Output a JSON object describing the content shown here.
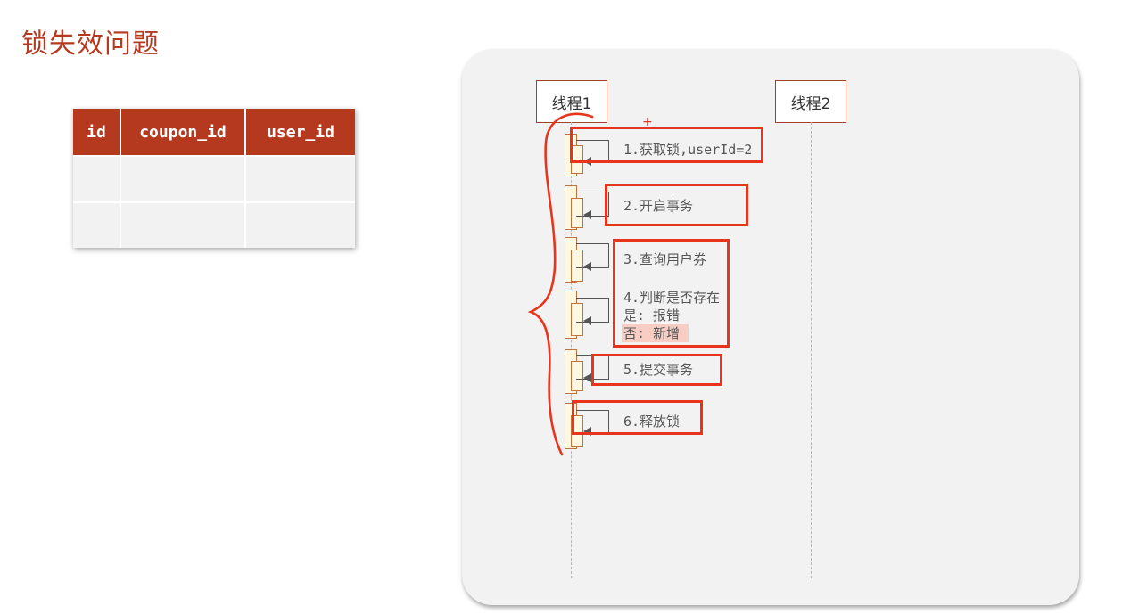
{
  "title": "锁失效问题",
  "table": {
    "columns": [
      "id",
      "coupon_id",
      "user_id"
    ],
    "rows": [
      [
        "",
        "",
        ""
      ],
      [
        "",
        "",
        ""
      ]
    ]
  },
  "diagram": {
    "thread1": "线程1",
    "thread2": "线程2",
    "steps": {
      "s1": "1.获取锁,userId=2",
      "s2": "2.开启事务",
      "s3": "3.查询用户券",
      "s4": "4.判断是否存在",
      "s4_yes": "是: 报错",
      "s4_no": "否: 新增",
      "s5": "5.提交事务",
      "s6": "6.释放锁"
    },
    "annotation_plus": "+"
  },
  "colors": {
    "accent": "#b5391f",
    "annotation_red": "#e8341c",
    "panel_bg": "#f2f2f2"
  }
}
